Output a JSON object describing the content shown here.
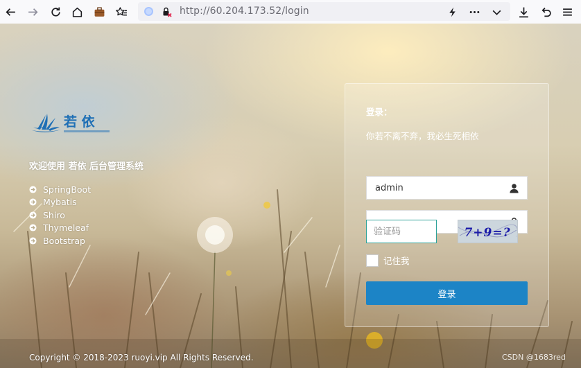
{
  "browser": {
    "url_host": "http://60.204.173.52",
    "url_path": "/login",
    "icons": [
      "back-icon",
      "forward-icon",
      "reload-icon",
      "home-icon",
      "briefcase-icon",
      "bookmarks-icon",
      "download-icon",
      "undo-icon",
      "menu-icon"
    ]
  },
  "brand": {
    "logo_text": "若 依"
  },
  "intro": {
    "welcome": "欢迎使用 若依 后台管理系统",
    "features": [
      "SpringBoot",
      "Mybatis",
      "Shiro",
      "Thymeleaf",
      "Bootstrap"
    ]
  },
  "login": {
    "title": "登录：",
    "subtitle": "你若不离不弃，我必生死相依",
    "username_value": "admin",
    "password_value": "••••••••",
    "captcha_placeholder": "验证码",
    "captcha_text": "7+9=?",
    "remember_label": "记住我",
    "submit_label": "登录"
  },
  "footer": {
    "copyright": "Copyright © 2018-2023 ruoyi.vip All Rights Reserved.",
    "watermark": "CSDN @1683red"
  },
  "colors": {
    "primary_button": "#1c84c6",
    "captcha_border": "#2fa39a",
    "logo_blue": "#1e6fb5"
  }
}
